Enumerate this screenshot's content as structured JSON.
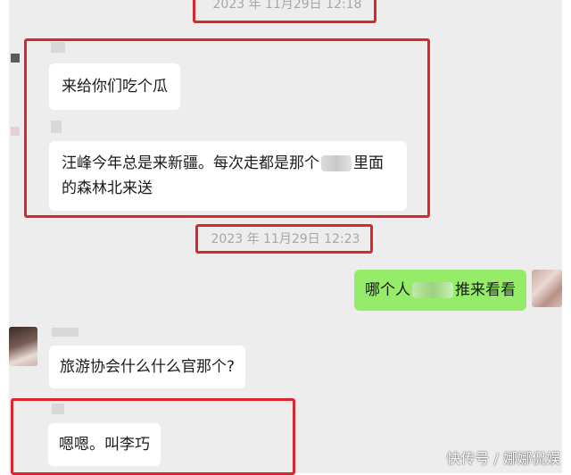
{
  "chat": {
    "timestamp_top": "2023 年 11月29日 12:18",
    "timestamp_mid": "2023 年 11月29日 12:23",
    "messages": [
      {
        "side": "left",
        "text": "来给你们吃个瓜"
      },
      {
        "side": "left",
        "line1_pre": "汪峰今年总是来新疆。每次走都是那个",
        "line1_post": "里面",
        "line2": "的森林北来送"
      },
      {
        "side": "right",
        "pre": "哪个人",
        "post": "推来看看"
      },
      {
        "side": "left",
        "text": "旅游协会什么什么官那个?"
      },
      {
        "side": "left",
        "text": "嗯嗯。叫李巧"
      }
    ]
  },
  "watermark": "快传号 / 娜娜侃娱",
  "colors": {
    "highlight_box": "#d9272b",
    "sent_bubble": "#95ec69",
    "received_bubble": "#ffffff",
    "chat_background": "#ededed"
  }
}
